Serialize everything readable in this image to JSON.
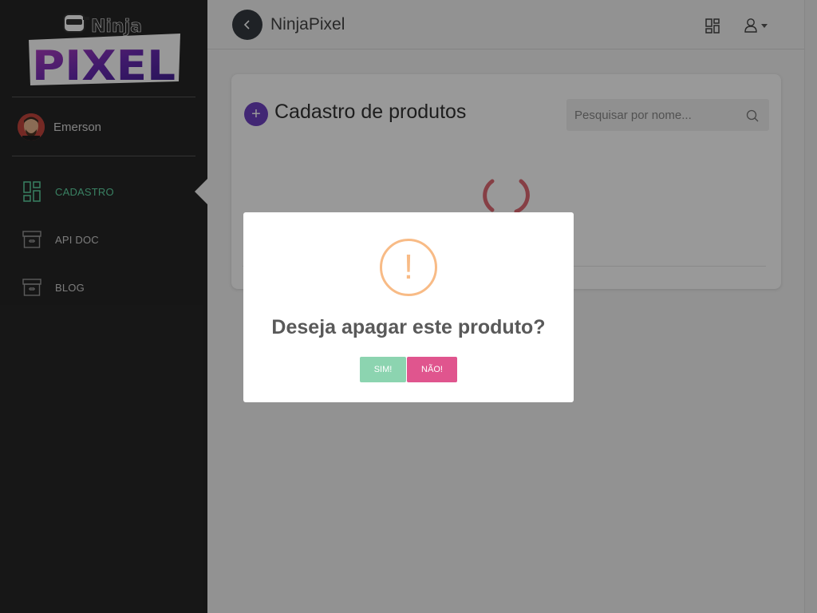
{
  "app": {
    "title": "NinjaPixel"
  },
  "logo": {
    "line1": "Ninja",
    "line2": "PIXEL"
  },
  "user": {
    "name": "Emerson"
  },
  "sidebar": {
    "items": [
      {
        "label": "CADASTRO",
        "icon": "dashboard-icon",
        "active": true
      },
      {
        "label": "API DOC",
        "icon": "archive-icon",
        "active": false
      },
      {
        "label": "BLOG",
        "icon": "archive-icon",
        "active": false
      }
    ]
  },
  "main": {
    "title": "Cadastro de produtos",
    "add_label": "+",
    "search": {
      "placeholder": "Pesquisar por nome..."
    }
  },
  "modal": {
    "icon": "!",
    "title": "Deseja apagar este produto?",
    "confirm_label": "SIM!",
    "cancel_label": "NÃO!"
  },
  "colors": {
    "sidebar_bg": "#262626",
    "active_nav": "#5fd6a3",
    "add_button": "#6f42c1",
    "confirm_button": "#8cd4b0",
    "cancel_button": "#e0558e",
    "warning": "#f8bb86",
    "spinner": "#e06a74"
  }
}
